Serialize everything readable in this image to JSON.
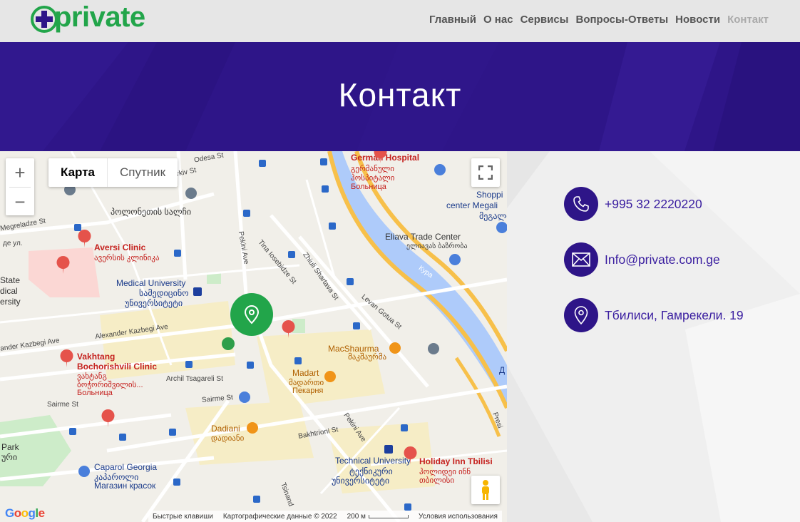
{
  "header": {
    "logo_text": "private",
    "nav": [
      {
        "label": "Главный",
        "active": false
      },
      {
        "label": "О нас",
        "active": false
      },
      {
        "label": "Сервисы",
        "active": false
      },
      {
        "label": "Вопросы-Ответы",
        "active": false
      },
      {
        "label": "Новости",
        "active": false
      },
      {
        "label": "Контакт",
        "active": true
      }
    ]
  },
  "hero": {
    "title": "Контакт"
  },
  "map": {
    "zoom_in": "+",
    "zoom_out": "−",
    "type_map": "Карта",
    "type_satellite": "Спутник",
    "labels": {
      "odesa": "Odesa St",
      "kharkiv": "Kharkiv St",
      "polonetebi": "პოლონეთის სალჩი",
      "megreladze": "Megreladze St",
      "aversi": "Aversi Clinic",
      "aversi_geo": "ავერსის კლინიკა",
      "state": "State",
      "dical": "dical",
      "ersity": "ersity",
      "medical_univ": "Medical University",
      "medical_univ_geo1": "სამედიცინო",
      "medical_univ_geo2": "უნივერსიტეტი",
      "pekini_ave": "Pekini Ave",
      "tina": "Tina Iosebidze St",
      "zhiuli": "Zhiuli Shartava St",
      "levan": "Levan Gotua St",
      "german_hospital": "German Hospital",
      "german_geo1": "გერმანული",
      "german_geo2": "ჰოსპიტალი",
      "german_ru": "Больница",
      "shopping": "Shoppi",
      "center_megali": "center Megali",
      "megali_geo": "მეგალი",
      "eliava": "Eliava Trade Center",
      "eliava_geo": "ელიავას ბაზრობა",
      "kura": "Кура",
      "kazbegi": "Alexander Kazbegi Ave",
      "kazbegi2": "ander Kazbegi Ave",
      "vakhtang": "Vakhtang",
      "bochorishvili": "Bochorishvili Clinic",
      "vakh_geo1": "ვახტანგ",
      "vakh_geo2": "ბოჭორიშვილის...",
      "vakh_ru": "Больница",
      "archil": "Archil Tsagareli St",
      "sairme": "Sairme St",
      "sairme2": "Sairme St",
      "macshaurma": "MacShaurma",
      "macshaurma_geo": "მაკშაურმა",
      "madart": "Madart",
      "madart_geo": "მადართი",
      "madart_ru": "Пекарня",
      "dadiani": "Dadiani",
      "dadiani_geo": "დადიანი",
      "bakhtrioni": "Bakhtrioni St",
      "pekini_ave2": "Pekini Ave",
      "technical": "Technical University",
      "technical_geo1": "ტექნიკური",
      "technical_geo2": "უნივერსიტეტი",
      "holiday": "Holiday Inn Tbilisi",
      "holiday_geo1": "ჰოლიდეი ინნ",
      "holiday_geo2": "თბილისი",
      "caparol": "Caparol Georgia",
      "caparol_geo": "კაპაროლი",
      "caparol_ru": "Магазин красок",
      "park": "Park",
      "park_geo": "ური",
      "presi": "Presi",
      "de_ul": "де ул.",
      "tsinandali": "Tsinand",
      "d_letter": "Д"
    },
    "google": "Google",
    "footer_keys": "Быстрые клавиши",
    "footer_data": "Картографические данные © 2022",
    "footer_scale": "200 м",
    "footer_terms": "Условия использования"
  },
  "contact": {
    "phone": "+995 32 2220220",
    "email": "Info@private.com.ge",
    "address": "Тбилиси, Гамрекели. 19"
  },
  "colors": {
    "brand_purple": "#2e1588",
    "brand_green": "#22a54a",
    "link": "#3a1ea0"
  }
}
